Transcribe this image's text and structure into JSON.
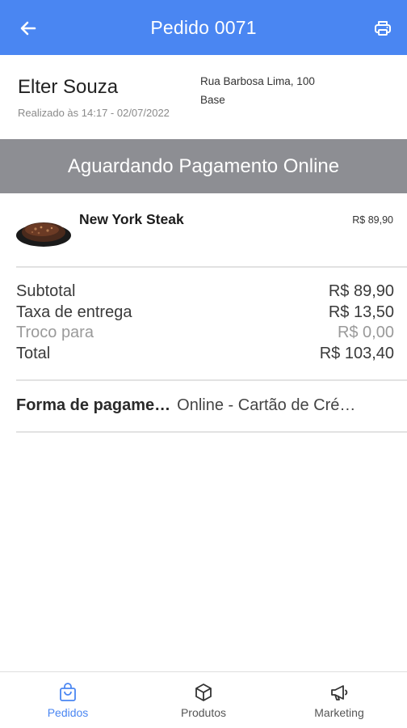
{
  "header": {
    "title": "Pedido 0071",
    "back_icon": "arrow-left-icon",
    "print_icon": "printer-icon",
    "color": "#4a86f2"
  },
  "customer": {
    "name": "Elter Souza",
    "placed_at": "Realizado às 14:17 - 02/07/2022",
    "address_line1": "Rua Barbosa Lima, 100",
    "address_line2": "Base"
  },
  "status": {
    "text": "Aguardando Pagamento Online",
    "color": "#8d8e93"
  },
  "items": [
    {
      "name": "New York Steak",
      "price": "R$ 89,90",
      "image_icon": "steak-image"
    }
  ],
  "totals": {
    "subtotal_label": "Subtotal",
    "subtotal_value": "R$ 89,90",
    "delivery_label": "Taxa de entrega",
    "delivery_value": "R$ 13,50",
    "change_label": "Troco para",
    "change_value": "R$ 0,00",
    "total_label": "Total",
    "total_value": "R$ 103,40"
  },
  "payment": {
    "label": "Forma de pagame…",
    "value": "Online - Cartão de Cré…"
  },
  "bottom_nav": [
    {
      "label": "Pedidos",
      "icon": "shopping-bag-icon",
      "active": true
    },
    {
      "label": "Produtos",
      "icon": "box-icon",
      "active": false
    },
    {
      "label": "Marketing",
      "icon": "megaphone-icon",
      "active": false
    }
  ]
}
